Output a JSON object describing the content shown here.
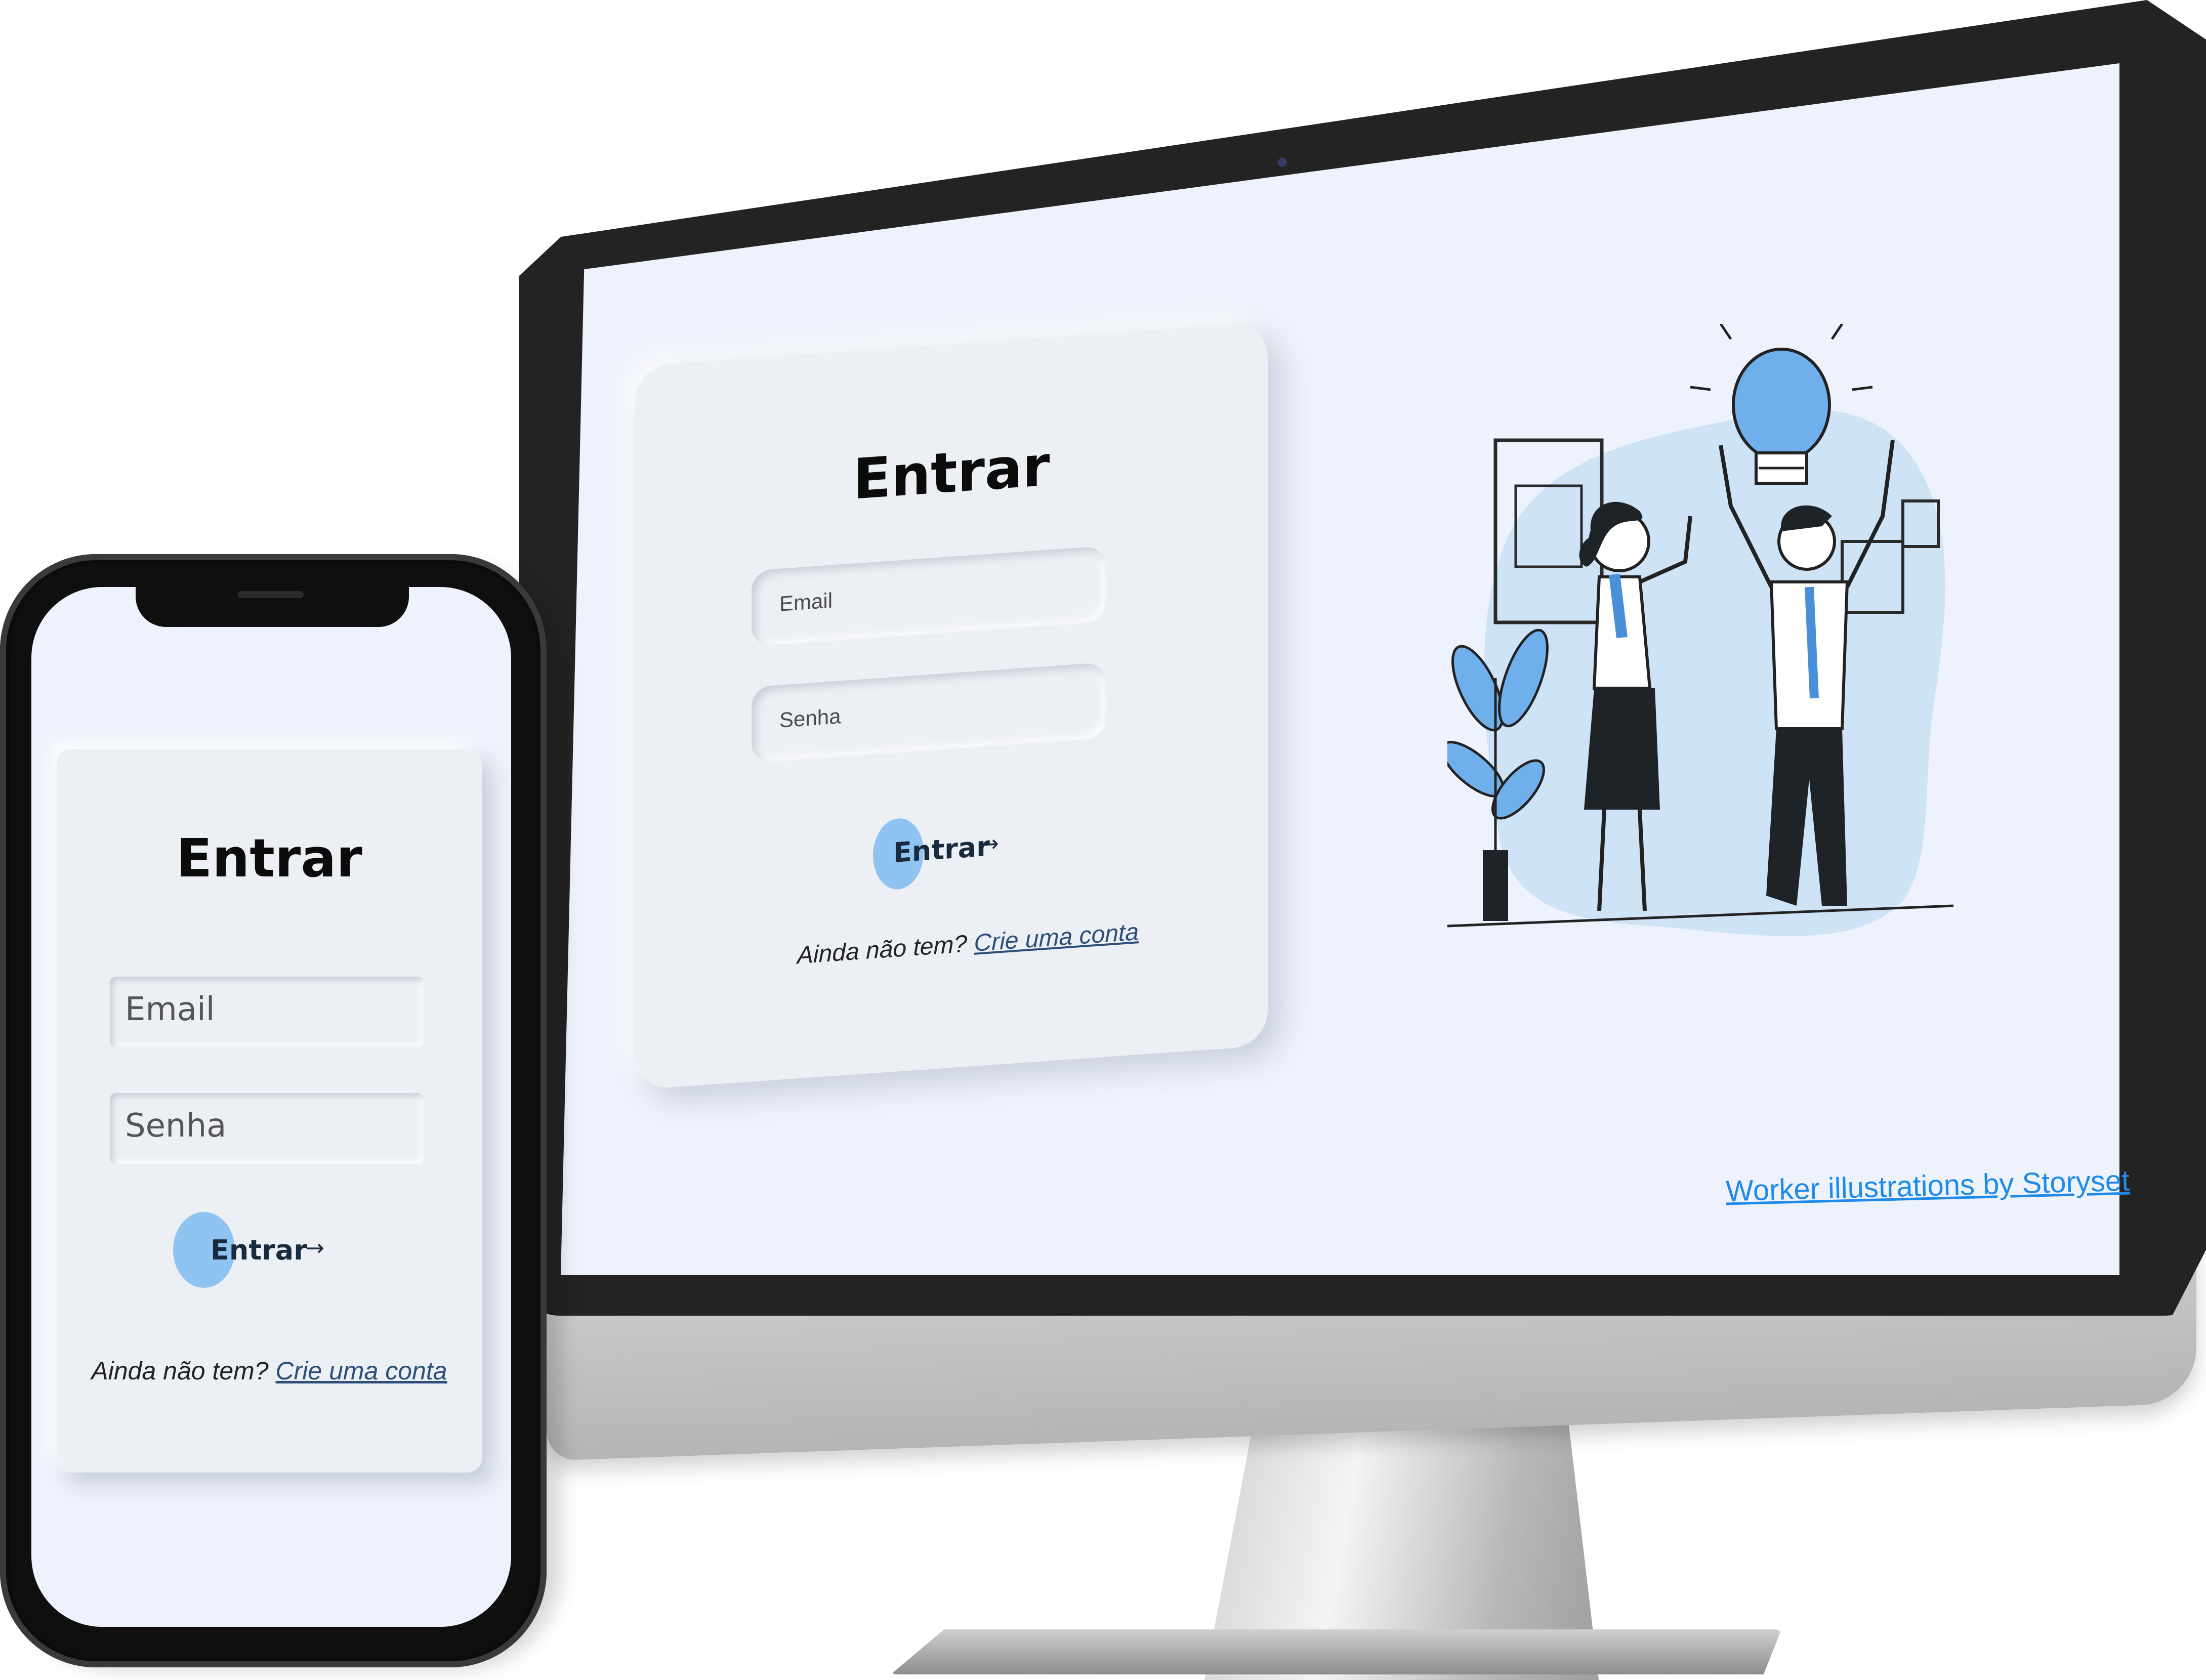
{
  "desktop": {
    "title": "Entrar",
    "email_placeholder": "Email",
    "password_placeholder": "Senha",
    "submit_label": "Entrar",
    "submit_arrow": "→",
    "footer_prompt": "Ainda não tem?",
    "footer_link": "Crie uma conta",
    "credit_link": "Worker illustrations by Storyset"
  },
  "mobile": {
    "title": "Entrar",
    "email_placeholder": "Email",
    "password_placeholder": "Senha",
    "submit_label": "Entrar",
    "submit_arrow": "→",
    "footer_prompt": "Ainda não tem?",
    "footer_link": "Crie uma conta"
  },
  "colors": {
    "background": "#eef2fc",
    "card": "#eceff3",
    "accent_blob": "#8ec3f2",
    "link": "#2c4e7a",
    "credit": "#1e8bea"
  },
  "icons": {
    "arrow": "arrow-right-icon",
    "illustration": "team-idea-illustration"
  }
}
